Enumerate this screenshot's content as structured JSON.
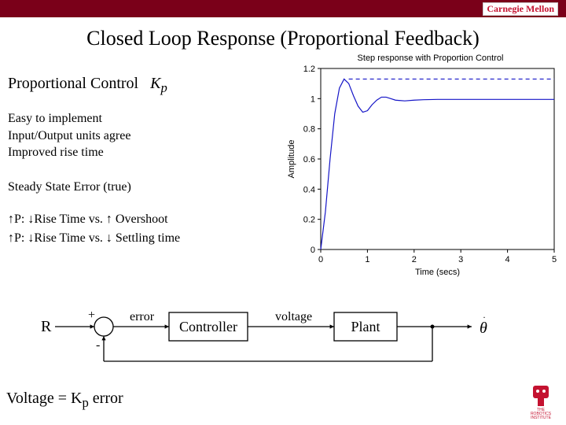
{
  "logo": {
    "text": "Carnegie Mellon"
  },
  "title": "Closed Loop Response (Proportional Feedback)",
  "subheading": {
    "label": "Proportional Control",
    "symbol": "K",
    "sub": "p"
  },
  "bullets": {
    "l1": "Easy to implement",
    "l2": "Input/Output units agree",
    "l3": "Improved rise time"
  },
  "sse": "Steady State Error (true)",
  "rel": {
    "l1_pre": "↑P: ↓Rise Time vs. ↑ Overshoot",
    "l2_pre": "↑P: ↓Rise Time vs. ↓ Settling time"
  },
  "diagram": {
    "R": "R",
    "plus": "+",
    "minus": "-",
    "error": "error",
    "controller": "Controller",
    "voltage": "voltage",
    "plant": "Plant",
    "theta": "θ",
    "thetadot": "·"
  },
  "equation": {
    "pre": "Voltage = K",
    "sub": "p",
    "post": " error"
  },
  "chart_data": {
    "type": "line",
    "title": "Step response with Proportion Control",
    "xlabel": "Time (secs)",
    "ylabel": "Amplitude",
    "xlim": [
      0,
      5
    ],
    "ylim": [
      0,
      1.2
    ],
    "xticks": [
      0,
      1,
      2,
      3,
      4,
      5
    ],
    "yticks": [
      0,
      0.2,
      0.4,
      0.6,
      0.8,
      1,
      1.2
    ],
    "series": [
      {
        "name": "response",
        "x": [
          0,
          0.1,
          0.2,
          0.3,
          0.4,
          0.5,
          0.6,
          0.7,
          0.8,
          0.9,
          1.0,
          1.1,
          1.2,
          1.3,
          1.4,
          1.5,
          1.6,
          1.8,
          2.0,
          2.2,
          2.5,
          3.0,
          3.5,
          4.0,
          4.5,
          5.0
        ],
        "y": [
          0,
          0.25,
          0.6,
          0.9,
          1.07,
          1.13,
          1.1,
          1.02,
          0.95,
          0.91,
          0.92,
          0.96,
          0.99,
          1.01,
          1.01,
          1.0,
          0.99,
          0.985,
          0.99,
          0.993,
          0.995,
          0.995,
          0.995,
          0.995,
          0.995,
          0.995
        ]
      },
      {
        "name": "reference",
        "x": [
          0.6,
          5.0
        ],
        "y": [
          1.13,
          1.13
        ],
        "dash": true
      }
    ]
  },
  "robo": {
    "line1": "THE",
    "line2": "ROBOTICS",
    "line3": "INSTITUTE"
  }
}
